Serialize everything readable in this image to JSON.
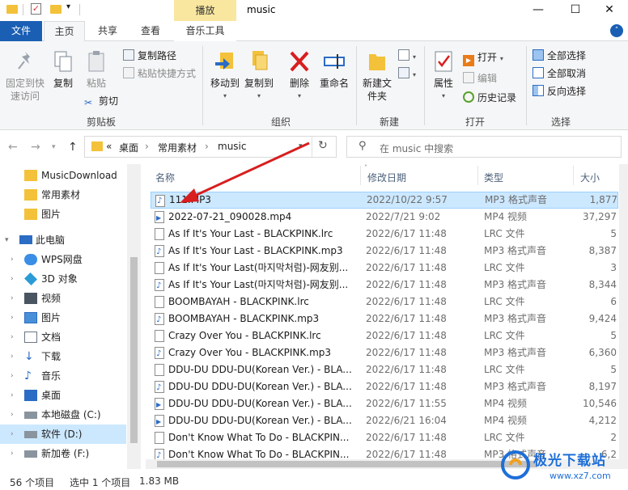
{
  "window": {
    "title": "music",
    "context_tab": "播放",
    "minimize": "—",
    "maximize": "☐",
    "close": "✕"
  },
  "tabs": {
    "file": "文件",
    "home": "主页",
    "share": "共享",
    "view": "查看",
    "music_tools": "音乐工具",
    "toggle": "˄"
  },
  "ribbon": {
    "clipboard": {
      "label": "剪贴板",
      "pin": "固定到快速访问",
      "copy": "复制",
      "paste": "粘贴",
      "copy_path": "复制路径",
      "paste_shortcut": "粘贴快捷方式",
      "cut": "剪切"
    },
    "organize": {
      "label": "组织",
      "move_to": "移动到",
      "copy_to": "复制到",
      "delete": "删除",
      "rename": "重命名"
    },
    "new": {
      "label": "新建",
      "new_folder": "新建文件夹"
    },
    "open": {
      "label": "打开",
      "properties": "属性",
      "open": "打开",
      "edit": "编辑",
      "history": "历史记录"
    },
    "select": {
      "label": "选择",
      "select_all": "全部选择",
      "select_none": "全部取消",
      "invert": "反向选择"
    }
  },
  "address": {
    "overflow": "«",
    "crumb1": "桌面",
    "crumb2": "常用素材",
    "crumb3": "music",
    "sep": "›",
    "search_placeholder": "在 music 中搜索"
  },
  "sidebar": {
    "items": [
      {
        "label": "MusicDownload",
        "icon": "folder-icon"
      },
      {
        "label": "常用素材",
        "icon": "folder-icon"
      },
      {
        "label": "图片",
        "icon": "folder-icon"
      },
      {
        "label": "此电脑",
        "icon": "computer-icon"
      },
      {
        "label": "WPS网盘",
        "icon": "cloud-icon"
      },
      {
        "label": "3D 对象",
        "icon": "cube-icon"
      },
      {
        "label": "视频",
        "icon": "film-icon"
      },
      {
        "label": "图片",
        "icon": "picture-icon"
      },
      {
        "label": "文档",
        "icon": "document-icon"
      },
      {
        "label": "下载",
        "icon": "download-icon"
      },
      {
        "label": "音乐",
        "icon": "music-icon"
      },
      {
        "label": "桌面",
        "icon": "desktop-icon"
      },
      {
        "label": "本地磁盘 (C:)",
        "icon": "drive-icon"
      },
      {
        "label": "软件 (D:)",
        "icon": "drive-icon"
      },
      {
        "label": "新加卷 (F:)",
        "icon": "drive-icon"
      }
    ]
  },
  "columns": {
    "name": "名称",
    "date": "修改日期",
    "type": "类型",
    "size": "大小"
  },
  "files": [
    {
      "name": "111.MP3",
      "date": "2022/10/22 9:57",
      "type": "MP3 格式声音",
      "size": "1,877",
      "kind": "music"
    },
    {
      "name": "2022-07-21_090028.mp4",
      "date": "2022/7/21 9:02",
      "type": "MP4 视频",
      "size": "37,297",
      "kind": "video"
    },
    {
      "name": "As If It's Your Last - BLACKPINK.lrc",
      "date": "2022/6/17 11:48",
      "type": "LRC 文件",
      "size": "5",
      "kind": "text"
    },
    {
      "name": "As If It's Your Last - BLACKPINK.mp3",
      "date": "2022/6/17 11:48",
      "type": "MP3 格式声音",
      "size": "8,387",
      "kind": "music"
    },
    {
      "name": "As If It's Your Last(마지막처럼)-网友别...",
      "date": "2022/6/17 11:48",
      "type": "LRC 文件",
      "size": "3",
      "kind": "text"
    },
    {
      "name": "As If It's Your Last(마지막처럼)-网友别...",
      "date": "2022/6/17 11:48",
      "type": "MP3 格式声音",
      "size": "8,344",
      "kind": "music"
    },
    {
      "name": "BOOMBAYAH - BLACKPINK.lrc",
      "date": "2022/6/17 11:48",
      "type": "LRC 文件",
      "size": "6",
      "kind": "text"
    },
    {
      "name": "BOOMBAYAH - BLACKPINK.mp3",
      "date": "2022/6/17 11:48",
      "type": "MP3 格式声音",
      "size": "9,424",
      "kind": "music"
    },
    {
      "name": "Crazy Over You - BLACKPINK.lrc",
      "date": "2022/6/17 11:48",
      "type": "LRC 文件",
      "size": "5",
      "kind": "text"
    },
    {
      "name": "Crazy Over You - BLACKPINK.mp3",
      "date": "2022/6/17 11:48",
      "type": "MP3 格式声音",
      "size": "6,360",
      "kind": "music"
    },
    {
      "name": "DDU-DU DDU-DU(Korean Ver.) - BLA...",
      "date": "2022/6/17 11:48",
      "type": "LRC 文件",
      "size": "5",
      "kind": "text"
    },
    {
      "name": "DDU-DU DDU-DU(Korean Ver.) - BLA...",
      "date": "2022/6/17 11:48",
      "type": "MP3 格式声音",
      "size": "8,197",
      "kind": "music"
    },
    {
      "name": "DDU-DU DDU-DU(Korean Ver.) - BLA...",
      "date": "2022/6/17 11:55",
      "type": "MP4 视频",
      "size": "10,546",
      "kind": "video"
    },
    {
      "name": "DDU-DU DDU-DU(Korean Ver.) - BLA...",
      "date": "2022/6/21 16:04",
      "type": "MP4 视频",
      "size": "4,212",
      "kind": "video"
    },
    {
      "name": "Don't Know What To Do - BLACKPIN...",
      "date": "2022/6/17 11:48",
      "type": "LRC 文件",
      "size": "2",
      "kind": "text"
    },
    {
      "name": "Don't Know What To Do - BLACKPIN...",
      "date": "2022/6/17 11:48",
      "type": "MP3 格式声音",
      "size": "6,2",
      "kind": "music"
    }
  ],
  "status": {
    "count": "56 个项目",
    "selected": "选中 1 个项目",
    "size": "1.83 MB"
  },
  "watermark": {
    "main": "极光下载站",
    "sub": "www.xz7.com"
  },
  "colors": {
    "accent": "#1a5fb4",
    "selection": "#cce8ff",
    "context_tab": "#f9e7a0",
    "arrow": "#d81e1e"
  }
}
